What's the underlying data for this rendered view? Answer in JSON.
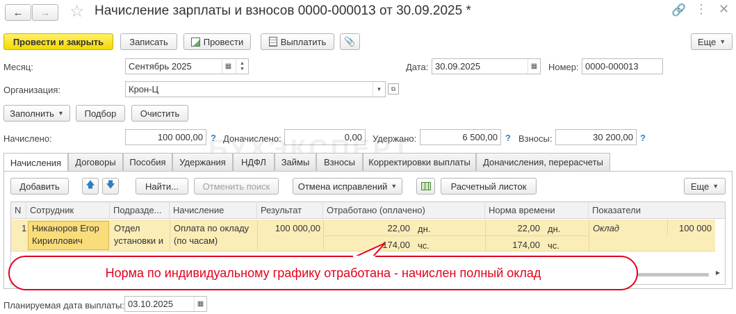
{
  "header": {
    "title": "Начисление зарплаты и взносов 0000-000013 от 30.09.2025 *"
  },
  "toolbar": {
    "post_close": "Провести и закрыть",
    "save": "Записать",
    "post": "Провести",
    "pay": "Выплатить",
    "more": "Еще"
  },
  "form": {
    "month_label": "Месяц:",
    "month_value": "Сентябрь 2025",
    "date_label": "Дата:",
    "date_value": "30.09.2025",
    "number_label": "Номер:",
    "number_value": "0000-000013",
    "org_label": "Организация:",
    "org_value": "Крон-Ц",
    "fill": "Заполнить",
    "select": "Подбор",
    "clear": "Очистить",
    "accrued_label": "Начислено:",
    "accrued_value": "100 000,00",
    "additional_label": "Доначислено:",
    "additional_value": "0,00",
    "withheld_label": "Удержано:",
    "withheld_value": "6 500,00",
    "contrib_label": "Взносы:",
    "contrib_value": "30 200,00",
    "help": "?",
    "planned_label": "Планируемая дата выплаты:",
    "planned_value": "03.10.2025"
  },
  "tabs": [
    "Начисления",
    "Договоры",
    "Пособия",
    "Удержания",
    "НДФЛ",
    "Займы",
    "Взносы",
    "Корректировки выплаты",
    "Доначисления, перерасчеты"
  ],
  "table_toolbar": {
    "add": "Добавить",
    "find": "Найти...",
    "cancel_search": "Отменить поиск",
    "cancel_fix": "Отмена исправлений",
    "payslip": "Расчетный листок",
    "more": "Еще"
  },
  "table": {
    "columns": [
      "N",
      "Сотрудник",
      "Подразде...",
      "Начисление",
      "Результат",
      "Отработано (оплачено)",
      "Норма времени",
      "Показатели"
    ],
    "row": {
      "n": "1",
      "employee_line1": "Никаноров Егор",
      "employee_line2": "Кириллович",
      "dept_line1": "Отдел",
      "dept_line2": "установки и",
      "accrual_line1": "Оплата по окладу",
      "accrual_line2": "(по часам)",
      "result": "100 000,00",
      "worked_days": "22,00",
      "unit_days": "дн.",
      "worked_hours": "174,00",
      "unit_hours": "чс.",
      "norm_days": "22,00",
      "norm_hours": "174,00",
      "indicator": "Оклад",
      "indicator_value": "100 000"
    }
  },
  "callout": {
    "text": "Норма по индивидуальному графику отработана - начислен полный оклад",
    "color": "#e3001b"
  },
  "watermark": "БУХЭКСПЕРТ",
  "colors": {
    "accent": "#f5d800",
    "selected_row": "#fbedb8",
    "active_cell": "#f8dd7a",
    "help": "#2e7fc0"
  }
}
